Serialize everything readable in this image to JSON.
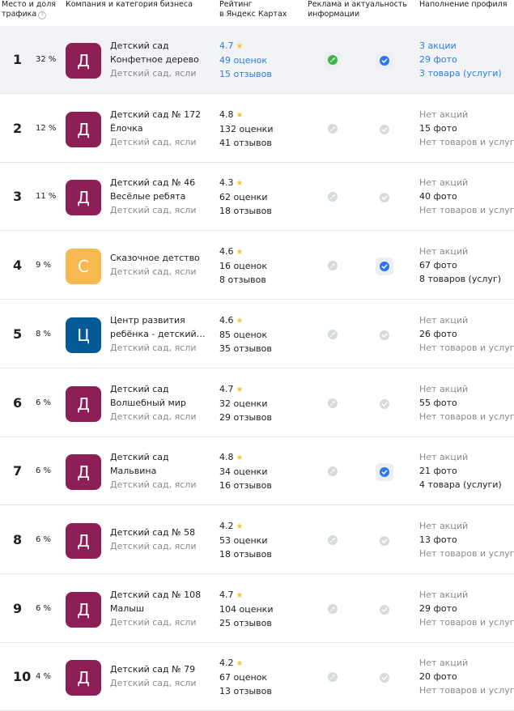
{
  "colors": {
    "avatar_crimson": "#8e1f56",
    "avatar_orange": "#f7b94f",
    "avatar_blue": "#045a96",
    "link_blue": "#2b7de2",
    "star_yellow": "#f6c23b",
    "check_blue": "#2c73f5",
    "ads_green": "#3bb54a"
  },
  "header": {
    "place_line1": "Место и доля",
    "place_line2": "трафика",
    "help_icon": "?",
    "company": "Компания и категория бизнеса",
    "rating_line1": "Рейтинг",
    "rating_line2": "в Яндекс Картах",
    "ads_line1": "Реклама и актуальность",
    "ads_line2": "информации",
    "profile": "Наполнение профиля"
  },
  "rows": [
    {
      "rank": "1",
      "share": "32 %",
      "letter": "Д",
      "avatar_color": "#8e1f56",
      "name_lines": [
        "Детский сад",
        "Конфетное дерево"
      ],
      "category": "Детский сад, ясли",
      "rating": "4.7",
      "ratings_count": "49 оценок",
      "reviews_count": "15 отзывов",
      "rating_link": true,
      "ads_icon": "rocket-active",
      "actual_icon": "check-active",
      "promos": "3 акции",
      "photos": "29 фото",
      "goods": "3 товара (услуги)",
      "profile_link": true,
      "highlight": true
    },
    {
      "rank": "2",
      "share": "12 %",
      "letter": "Д",
      "avatar_color": "#8e1f56",
      "name_lines": [
        "Детский сад № 172",
        "Ёлочка"
      ],
      "category": "Детский сад, ясли",
      "rating": "4.8",
      "ratings_count": "132 оценки",
      "reviews_count": "41 отзывов",
      "rating_link": false,
      "ads_icon": "rocket-inactive",
      "actual_icon": "check-inactive",
      "promos": "Нет акций",
      "photos": "15 фото",
      "goods": "Нет товаров и услуг",
      "profile_link": false,
      "highlight": false
    },
    {
      "rank": "3",
      "share": "11 %",
      "letter": "Д",
      "avatar_color": "#8e1f56",
      "name_lines": [
        "Детский сад № 46",
        "Весёлые ребята"
      ],
      "category": "Детский сад, ясли",
      "rating": "4.3",
      "ratings_count": "62 оценки",
      "reviews_count": "18 отзывов",
      "rating_link": false,
      "ads_icon": "rocket-inactive",
      "actual_icon": "check-inactive",
      "promos": "Нет акций",
      "photos": "40 фото",
      "goods": "Нет товаров и услуг",
      "profile_link": false,
      "highlight": false
    },
    {
      "rank": "4",
      "share": "9 %",
      "letter": "С",
      "avatar_color": "#f7b94f",
      "name_lines": [
        "Сказочное детство"
      ],
      "category": "Детский сад, ясли",
      "rating": "4.6",
      "ratings_count": "16 оценок",
      "reviews_count": "8 отзывов",
      "rating_link": false,
      "ads_icon": "rocket-inactive",
      "actual_icon": "check-active",
      "promos": "Нет акций",
      "photos": "67 фото",
      "goods": "8 товаров (услуг)",
      "profile_link": false,
      "highlight": false
    },
    {
      "rank": "5",
      "share": "8 %",
      "letter": "Ц",
      "avatar_color": "#045a96",
      "name_lines": [
        "Центр развития",
        "ребёнка - детский…"
      ],
      "category": "Детский сад, ясли",
      "rating": "4.6",
      "ratings_count": "85 оценок",
      "reviews_count": "35 отзывов",
      "rating_link": false,
      "ads_icon": "rocket-inactive",
      "actual_icon": "check-inactive",
      "promos": "Нет акций",
      "photos": "26 фото",
      "goods": "Нет товаров и услуг",
      "profile_link": false,
      "highlight": false
    },
    {
      "rank": "6",
      "share": "6 %",
      "letter": "Д",
      "avatar_color": "#8e1f56",
      "name_lines": [
        "Детский сад",
        "Волшебный мир"
      ],
      "category": "Детский сад, ясли",
      "rating": "4.7",
      "ratings_count": "32 оценки",
      "reviews_count": "29 отзывов",
      "rating_link": false,
      "ads_icon": "rocket-inactive",
      "actual_icon": "check-inactive",
      "promos": "Нет акций",
      "photos": "55 фото",
      "goods": "Нет товаров и услуг",
      "profile_link": false,
      "highlight": false
    },
    {
      "rank": "7",
      "share": "6 %",
      "letter": "Д",
      "avatar_color": "#8e1f56",
      "name_lines": [
        "Детский сад",
        "Мальвина"
      ],
      "category": "Детский сад, ясли",
      "rating": "4.8",
      "ratings_count": "34 оценки",
      "reviews_count": "16 отзывов",
      "rating_link": false,
      "ads_icon": "rocket-inactive",
      "actual_icon": "check-active",
      "promos": "Нет акций",
      "photos": "21 фото",
      "goods": "4 товара (услуги)",
      "profile_link": false,
      "highlight": false
    },
    {
      "rank": "8",
      "share": "6 %",
      "letter": "Д",
      "avatar_color": "#8e1f56",
      "name_lines": [
        "Детский сад № 58"
      ],
      "category": "Детский сад, ясли",
      "rating": "4.2",
      "ratings_count": "53 оценки",
      "reviews_count": "18 отзывов",
      "rating_link": false,
      "ads_icon": "rocket-inactive",
      "actual_icon": "check-inactive",
      "promos": "Нет акций",
      "photos": "13 фото",
      "goods": "Нет товаров и услуг",
      "profile_link": false,
      "highlight": false
    },
    {
      "rank": "9",
      "share": "6 %",
      "letter": "Д",
      "avatar_color": "#8e1f56",
      "name_lines": [
        "Детский сад № 108",
        "Малыш"
      ],
      "category": "Детский сад, ясли",
      "rating": "4.7",
      "ratings_count": "104 оценки",
      "reviews_count": "25 отзывов",
      "rating_link": false,
      "ads_icon": "rocket-inactive",
      "actual_icon": "check-inactive",
      "promos": "Нет акций",
      "photos": "29 фото",
      "goods": "Нет товаров и услуг",
      "profile_link": false,
      "highlight": false
    },
    {
      "rank": "10",
      "share": "4 %",
      "letter": "Д",
      "avatar_color": "#8e1f56",
      "name_lines": [
        "Детский сад № 79"
      ],
      "category": "Детский сад, ясли",
      "rating": "4.2",
      "ratings_count": "67 оценок",
      "reviews_count": "13 отзывов",
      "rating_link": false,
      "ads_icon": "rocket-inactive",
      "actual_icon": "check-inactive",
      "promos": "Нет акций",
      "photos": "20 фото",
      "goods": "Нет товаров и услуг",
      "profile_link": false,
      "highlight": false
    }
  ]
}
